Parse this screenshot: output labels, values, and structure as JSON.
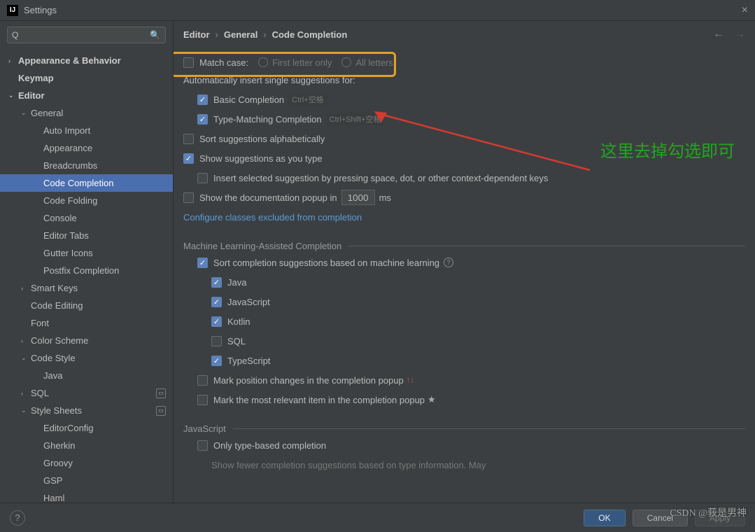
{
  "window": {
    "title": "Settings"
  },
  "search": {
    "placeholder": ""
  },
  "tree": [
    {
      "label": "Appearance & Behavior",
      "exp": "›",
      "top": true,
      "ind": 0
    },
    {
      "label": "Keymap",
      "exp": "",
      "top": true,
      "ind": 0
    },
    {
      "label": "Editor",
      "exp": "⌄",
      "top": true,
      "ind": 0
    },
    {
      "label": "General",
      "exp": "⌄",
      "ind": 1
    },
    {
      "label": "Auto Import",
      "ind": 2
    },
    {
      "label": "Appearance",
      "ind": 2
    },
    {
      "label": "Breadcrumbs",
      "ind": 2
    },
    {
      "label": "Code Completion",
      "ind": 2,
      "sel": true
    },
    {
      "label": "Code Folding",
      "ind": 2
    },
    {
      "label": "Console",
      "ind": 2
    },
    {
      "label": "Editor Tabs",
      "ind": 2
    },
    {
      "label": "Gutter Icons",
      "ind": 2
    },
    {
      "label": "Postfix Completion",
      "ind": 2
    },
    {
      "label": "Smart Keys",
      "exp": "›",
      "ind": 1
    },
    {
      "label": "Code Editing",
      "ind": 1
    },
    {
      "label": "Font",
      "ind": 1
    },
    {
      "label": "Color Scheme",
      "exp": "›",
      "ind": 1
    },
    {
      "label": "Code Style",
      "exp": "⌄",
      "ind": 1
    },
    {
      "label": "Java",
      "ind": 2
    },
    {
      "label": "SQL",
      "exp": "›",
      "ind": 1,
      "badge": true
    },
    {
      "label": "Style Sheets",
      "exp": "⌄",
      "ind": 1,
      "badge": true
    },
    {
      "label": "EditorConfig",
      "ind": 2
    },
    {
      "label": "Gherkin",
      "ind": 2
    },
    {
      "label": "Groovy",
      "ind": 2
    },
    {
      "label": "GSP",
      "ind": 2
    },
    {
      "label": "Haml",
      "ind": 2
    }
  ],
  "crumbs": [
    "Editor",
    "General",
    "Code Completion"
  ],
  "content": {
    "match_case": "Match case:",
    "first_letter": "First letter only",
    "all_letters": "All letters",
    "auto_insert": "Automatically insert single suggestions for:",
    "basic": "Basic Completion",
    "basic_hint": "Ctrl+空格",
    "typematch": "Type-Matching Completion",
    "typematch_hint": "Ctrl+Shift+空格",
    "sort_alpha": "Sort suggestions alphabetically",
    "show_type": "Show suggestions as you type",
    "insert_space": "Insert selected suggestion by pressing space, dot, or other context-dependent keys",
    "show_doc": "Show the documentation popup in",
    "doc_ms_val": "1000",
    "doc_ms_unit": "ms",
    "configure_link": "Configure classes excluded from completion",
    "ml_header": "Machine Learning-Assisted Completion",
    "ml_sort": "Sort completion suggestions based on machine learning",
    "lang_java": "Java",
    "lang_js": "JavaScript",
    "lang_kotlin": "Kotlin",
    "lang_sql": "SQL",
    "lang_ts": "TypeScript",
    "mark_pos": "Mark position changes in the completion popup",
    "mark_rel": "Mark the most relevant item in the completion popup",
    "js_header": "JavaScript",
    "js_only_type": "Only type-based completion",
    "js_hint": "Show fewer completion suggestions based on type information. May"
  },
  "annotation": "这里去掉勾选即可",
  "footer": {
    "ok": "OK",
    "cancel": "Cancel",
    "apply": "Apply"
  },
  "watermark": "CSDN @莪是男神"
}
